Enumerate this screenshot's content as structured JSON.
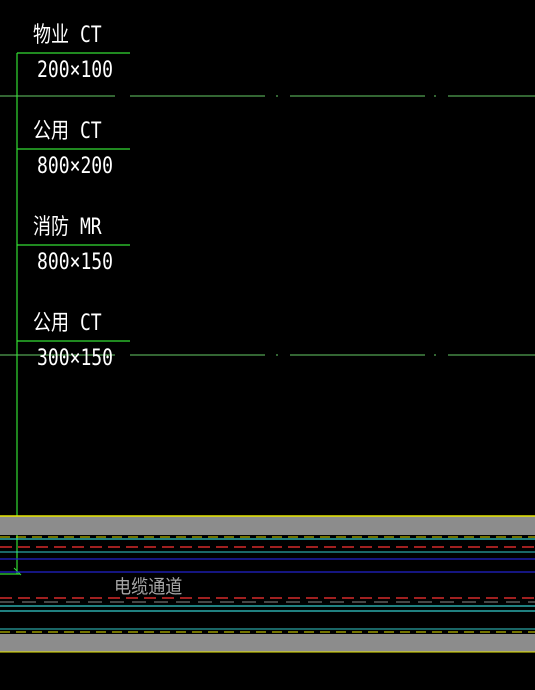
{
  "colors": {
    "background": "#000000",
    "leader": "#33dd33",
    "axis": "#66cc66",
    "text": "#ffffff",
    "band_fill": "#8c8c8c",
    "yellow": "#e6e600",
    "cyan": "#33cccc",
    "red_dashed": "#ff3333",
    "blue": "#2222cc",
    "label_gray": "#a6a6a6"
  },
  "annotations": [
    {
      "system": "物业 CT",
      "size": "200×100"
    },
    {
      "system": "公用 CT",
      "size": "800×200"
    },
    {
      "system": "消防 MR",
      "size": "800×150"
    },
    {
      "system": "公用 CT",
      "size": "300×150"
    }
  ],
  "cable_channel": {
    "label": "电缆通道"
  }
}
